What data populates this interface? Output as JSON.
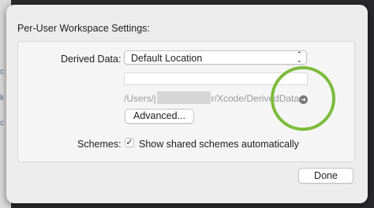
{
  "background": {
    "glyphs": [
      "c",
      "k",
      "c"
    ]
  },
  "dialog": {
    "title": "Per-User Workspace Settings:",
    "derived_data": {
      "label": "Derived Data:",
      "selected": "Default Location",
      "path_prefix": "/Users/j",
      "path_suffix": "r/Xcode/DerivedData",
      "advanced_button": "Advanced..."
    },
    "schemes": {
      "label": "Schemes:",
      "checkbox_label": "Show shared schemes automatically",
      "checked": true
    },
    "done_button": "Done"
  },
  "colors": {
    "highlight_circle": "#7cbb3b"
  }
}
